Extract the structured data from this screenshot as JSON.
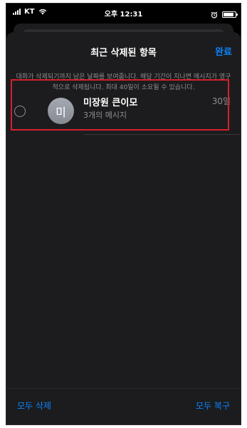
{
  "status_bar": {
    "carrier": "KT",
    "time": "오후 12:31"
  },
  "sheet": {
    "title": "최근 삭제된 항목",
    "done_label": "완료",
    "notice": "대화가 삭제되기까지 남은 날짜를 보여줍니다. 해당 기간이 지나면 메시지가 영구적으로 삭제됩니다. 최대 40일이 소요될 수 있습니다."
  },
  "conversations": [
    {
      "avatar_initial": "미",
      "name": "미장원 큰이모",
      "count": "3개의 메시지",
      "days": "30일"
    }
  ],
  "bottom": {
    "delete_all": "모두 삭제",
    "restore_all": "모두 복구"
  },
  "colors": {
    "accent": "#0a84ff",
    "highlight": "#d3202a",
    "background": "#1c1c1e"
  }
}
